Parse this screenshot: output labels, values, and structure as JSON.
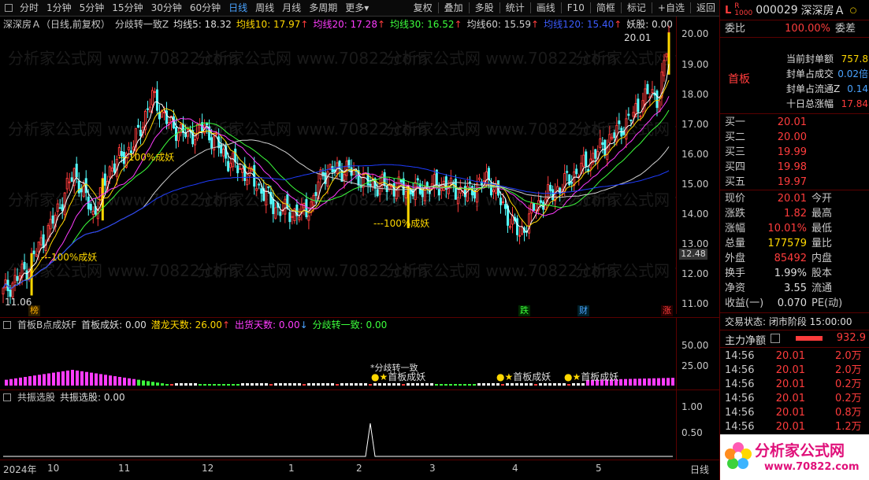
{
  "toolbar": {
    "periods": [
      "分时",
      "1分钟",
      "5分钟",
      "15分钟",
      "30分钟",
      "60分钟",
      "日线",
      "周线",
      "月线",
      "多周期",
      "更多"
    ],
    "active_period": "日线",
    "more_suffix": "▾",
    "actions": [
      "复权",
      "叠加",
      "多股",
      "统计",
      "画线",
      "F10",
      "简框",
      "标记",
      "+自选",
      "返回"
    ]
  },
  "main_legend": {
    "title": "深深房Ａ（日线,前复权）",
    "indicator": "分歧转一致Z",
    "ma5": "均线5: 18.32",
    "ma10": "均线10: 17.97",
    "ma20": "均线20: 17.28",
    "ma30": "均线30: 16.52",
    "ma60": "均线60: 15.59",
    "ma120": "均线120: 15.40",
    "yao": "妖股: 0.00",
    "arrow_up": "↑",
    "arrow_down": "↓"
  },
  "price_axis": [
    "20.00",
    "19.00",
    "18.00",
    "17.00",
    "16.00",
    "15.00",
    "14.00",
    "13.00",
    "12.00",
    "11.00"
  ],
  "price_tag": "12.48",
  "annotations": {
    "high_label": "20.01",
    "low_label": "11.06",
    "yao_label": "---100%成妖",
    "markers": [
      "榜",
      "跌",
      "财",
      "涨"
    ]
  },
  "sub1_legend": {
    "name": "首板B点成妖F",
    "first": "首板成妖: 0.00",
    "qianlong": "潜龙天数: 26.00",
    "chuhuo": "出货天数: 0.00",
    "fenqi": "分歧转一致: 0.00",
    "arrow_up": "↑",
    "arrow_down": "↓"
  },
  "sub1_axis": [
    "50.00",
    "25.00"
  ],
  "sub1_labels": {
    "fenqi_text": "*分歧转一致",
    "shouban": "首板成妖"
  },
  "sub2_legend": {
    "name": "共振选股",
    "value": "共振选股: 0.00"
  },
  "sub2_axis": [
    "1.00",
    "0.50"
  ],
  "date_axis": [
    "2024年",
    "10",
    "11",
    "12",
    "1",
    "2",
    "3",
    "4",
    "5"
  ],
  "date_axis_right": "日线",
  "right_panel": {
    "code": "000029",
    "name": "深深房Ａ",
    "tag_l": "L",
    "tag_r": "R",
    "tag_sub": "1000",
    "weibi_label": "委比",
    "weibi_value": "100.00%",
    "weicha_label": "委差",
    "first_board": "首板",
    "stats": [
      {
        "label": "当前封单额",
        "value": "757.8"
      },
      {
        "label": "封单占成交",
        "value": "0.02倍"
      },
      {
        "label": "封单占流通Z",
        "value": "0.14"
      },
      {
        "label": "十日总涨幅",
        "value": "17.84"
      }
    ],
    "bids": [
      {
        "label": "买一",
        "price": "20.01"
      },
      {
        "label": "买二",
        "price": "20.00"
      },
      {
        "label": "买三",
        "price": "19.99"
      },
      {
        "label": "买四",
        "price": "19.98"
      },
      {
        "label": "买五",
        "price": "19.97"
      }
    ],
    "quote": [
      {
        "l1": "现价",
        "v1": "20.01",
        "l2": "今开"
      },
      {
        "l1": "涨跌",
        "v1": "1.82",
        "l2": "最高"
      },
      {
        "l1": "涨幅",
        "v1": "10.01%",
        "l2": "最低"
      },
      {
        "l1": "总量",
        "v1": "177579",
        "l2": "量比"
      },
      {
        "l1": "外盘",
        "v1": "85492",
        "l2": "内盘"
      },
      {
        "l1": "换手",
        "v1": "1.99%",
        "l2": "股本"
      },
      {
        "l1": "净资",
        "v1": "3.55",
        "l2": "流通"
      },
      {
        "l1": "收益(一)",
        "v1": "0.070",
        "l2": "PE(动)"
      }
    ],
    "trade_status": "交易状态: 闭市阶段 15:00:00",
    "main_net_label": "主力净额",
    "main_net_value": "932.9",
    "ticks": [
      {
        "time": "14:56",
        "price": "20.01",
        "vol": "2.0万"
      },
      {
        "time": "14:56",
        "price": "20.01",
        "vol": "2.0万"
      },
      {
        "time": "14:56",
        "price": "20.01",
        "vol": "0.2万"
      },
      {
        "time": "14:56",
        "price": "20.01",
        "vol": "0.2万"
      },
      {
        "time": "14:56",
        "price": "20.01",
        "vol": "0.8万"
      },
      {
        "time": "14:56",
        "price": "20.01",
        "vol": "1.2万"
      }
    ],
    "logo_text": "分析家公式网",
    "logo_url": "www.70822.com"
  },
  "colors": {
    "up": "#ff3c3c",
    "down": "#54ffff",
    "ma5": "#ffffff",
    "ma10": "#ffd800",
    "ma20": "#ff3cff",
    "ma30": "#3cff3c",
    "ma60": "#d0d0d0",
    "ma120": "#1e3cff",
    "accent": "#4aa3ff"
  }
}
